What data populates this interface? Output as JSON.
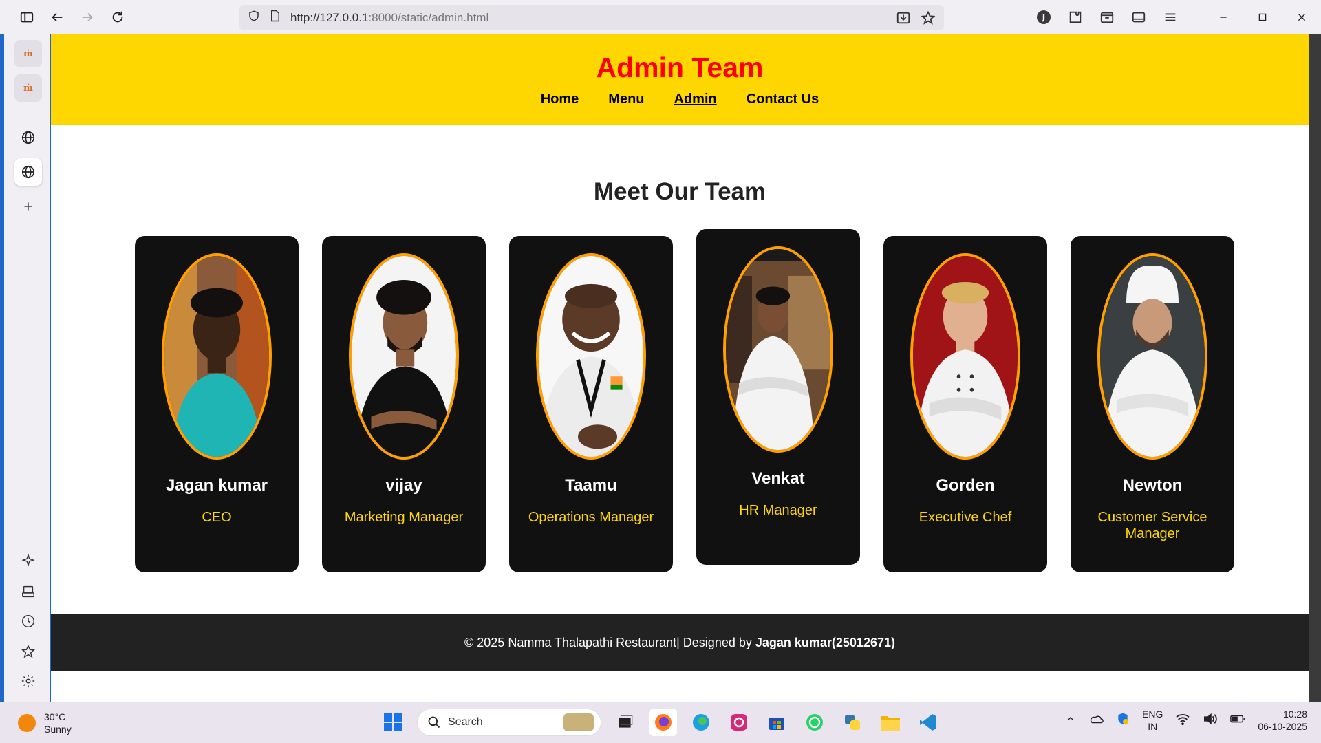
{
  "browser": {
    "url_host": "http://127.0.0.1",
    "url_rest": ":8000/static/admin.html",
    "profile_initial": "J"
  },
  "header": {
    "title": "Admin Team",
    "nav": [
      {
        "label": "Home"
      },
      {
        "label": "Menu"
      },
      {
        "label": "Admin",
        "current": true
      },
      {
        "label": "Contact Us"
      }
    ]
  },
  "main": {
    "section_title": "Meet Our Team",
    "team": [
      {
        "name": "Jagan kumar",
        "role": "CEO"
      },
      {
        "name": "vijay",
        "role": "Marketing Manager"
      },
      {
        "name": "Taamu",
        "role": "Operations Manager"
      },
      {
        "name": "Venkat",
        "role": "HR Manager"
      },
      {
        "name": "Gorden",
        "role": "Executive Chef"
      },
      {
        "name": "Newton",
        "role": "Customer Service Manager"
      }
    ]
  },
  "footer": {
    "text": "© 2025 Namma Thalapathi Restaurant| Designed by ",
    "author": "Jagan kumar(25012671)"
  },
  "taskbar": {
    "weather_temp": "30°C",
    "weather_desc": "Sunny",
    "search_placeholder": "Search",
    "lang_top": "ENG",
    "lang_bottom": "IN",
    "time": "10:28",
    "date": "06-10-2025"
  },
  "colors": {
    "header_bg": "#ffd700",
    "title_red": "#ff0000",
    "card_bg": "#111111",
    "portrait_border": "#ff9f00",
    "role_yellow": "#ffd700",
    "footer_bg": "#222222"
  }
}
